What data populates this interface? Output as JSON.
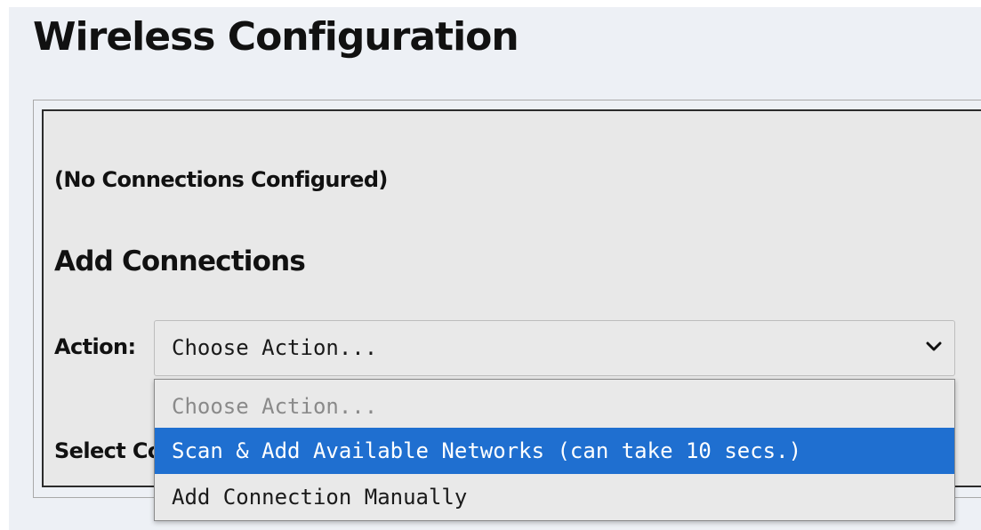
{
  "page": {
    "title": "Wireless Configuration"
  },
  "status": {
    "no_connections": "(No Connections Configured)"
  },
  "add_connections": {
    "heading": "Add Connections",
    "action_label": "Action:",
    "select_value": "Choose Action...",
    "select_other_label": "Select Connection",
    "options": [
      {
        "label": "Choose Action...",
        "state": "disabled"
      },
      {
        "label": "Scan & Add Available Networks (can take 10 secs.)",
        "state": "highlighted"
      },
      {
        "label": "Add Connection Manually",
        "state": "normal"
      }
    ]
  },
  "icons": {
    "select_arrow": "chevron-down-icon"
  },
  "colors": {
    "page_background": "#edf0f5",
    "panel_background": "#e8e8e8",
    "highlight": "#1f6fd0"
  }
}
